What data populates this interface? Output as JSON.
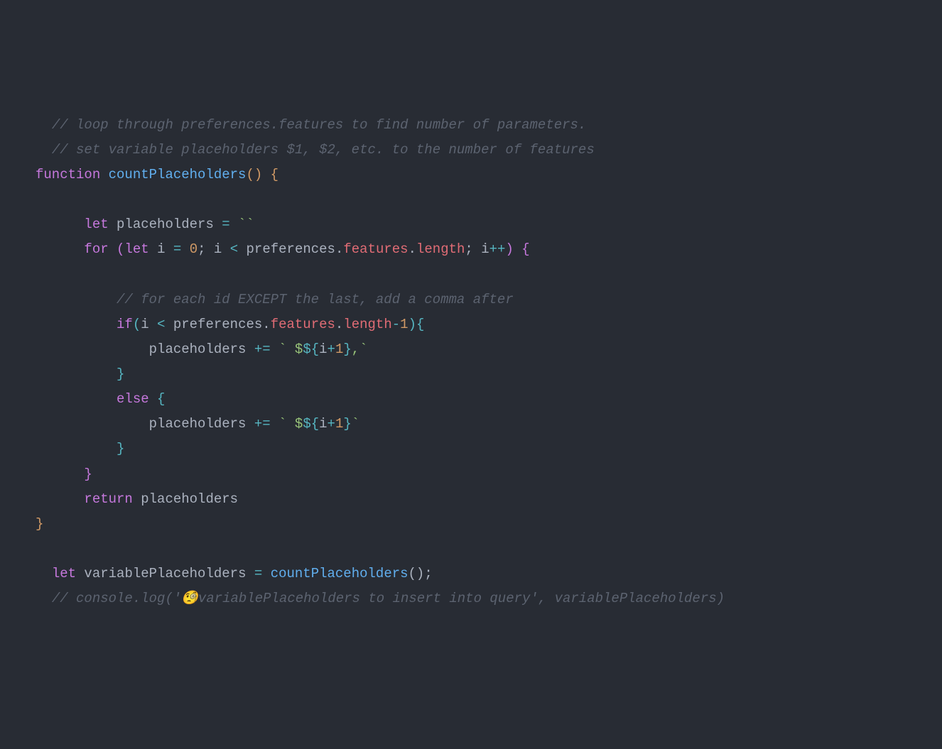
{
  "code": {
    "l1_comment": "// loop through preferences.features to find number of parameters.",
    "l2_comment": "// set variable placeholders $1, $2, etc. to the number of features",
    "l3_function": "function",
    "l3_name": "countPlaceholders",
    "l3_parens": "()",
    "l3_brace": " {",
    "l5_let": "let",
    "l5_var": " placeholders ",
    "l5_eq": "=",
    "l5_str": " ``",
    "l6_for": "for",
    "l6_open": " (",
    "l6_let": "let",
    "l6_i": " i ",
    "l6_eq": "=",
    "l6_space": " ",
    "l6_zero": "0",
    "l6_semi1": "; i ",
    "l6_lt": "<",
    "l6_pref": " preferences",
    "l6_dot1": ".",
    "l6_feat": "features",
    "l6_dot2": ".",
    "l6_len": "length",
    "l6_semi2": "; i",
    "l6_inc": "++",
    "l6_close": ") ",
    "l6_brace": "{",
    "l8_comment": "// for each id EXCEPT the last, add a comma after",
    "l9_if": "if",
    "l9_open": "(",
    "l9_i": "i ",
    "l9_lt": "<",
    "l9_pref": " preferences",
    "l9_dot1": ".",
    "l9_feat": "features",
    "l9_dot2": ".",
    "l9_len": "length",
    "l9_minus": "-",
    "l9_one": "1",
    "l9_close": ")",
    "l9_brace": "{",
    "l10_var": "placeholders ",
    "l10_peq": "+=",
    "l10_tick1": " `",
    "l10_lit": " $",
    "l10_dopen": "${",
    "l10_i": "i",
    "l10_plus": "+",
    "l10_one": "1",
    "l10_dclose": "}",
    "l10_comma": ",",
    "l10_tick2": "`",
    "l11_brace": "}",
    "l12_else": "else",
    "l12_brace": " {",
    "l13_var": "placeholders ",
    "l13_peq": "+=",
    "l13_tick1": " `",
    "l13_lit": " $",
    "l13_dopen": "${",
    "l13_i": "i",
    "l13_plus": "+",
    "l13_one": "1",
    "l13_dclose": "}",
    "l13_tick2": "`",
    "l14_brace": "}",
    "l15_brace": "}",
    "l16_return": "return",
    "l16_var": " placeholders",
    "l17_brace": "}",
    "l19_let": "let",
    "l19_var": " variablePlaceholders ",
    "l19_eq": "=",
    "l19_space": " ",
    "l19_fn": "countPlaceholders",
    "l19_call": "();",
    "l20_comment1": "// console.log('",
    "l20_emoji": "🧐",
    "l20_comment2": "variablePlaceholders to insert into query', variablePlaceholders)"
  }
}
